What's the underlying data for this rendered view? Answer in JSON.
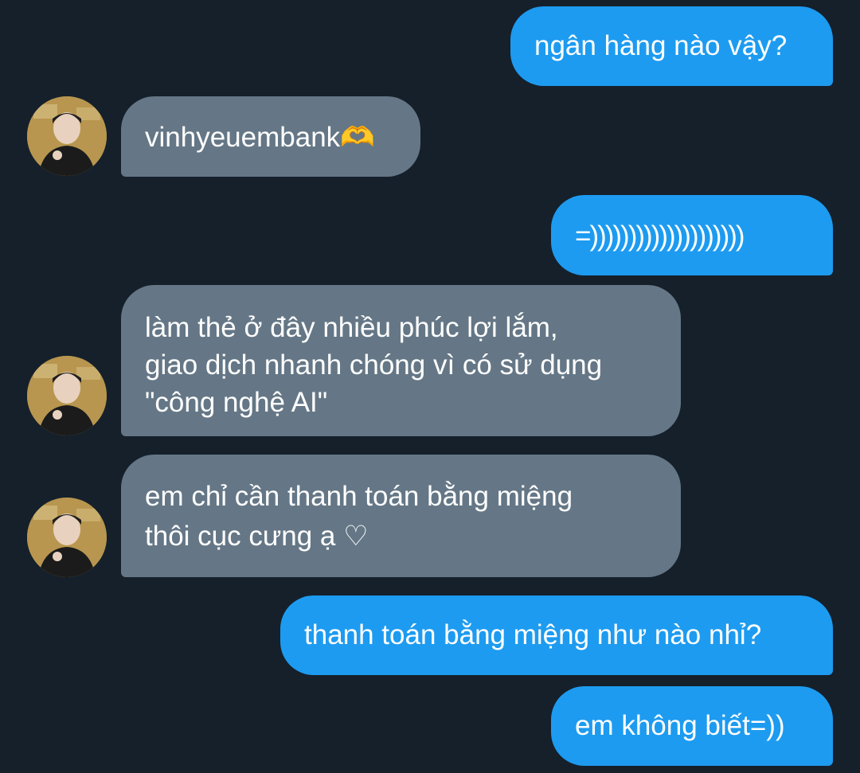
{
  "messages": [
    {
      "side": "sent",
      "lines": [
        "ngân hàng nào vậy?"
      ]
    },
    {
      "side": "recv",
      "lines": [
        "vinhyeuembank🫶"
      ]
    },
    {
      "side": "sent",
      "lines": [
        "=))))))))))))))))))))"
      ]
    },
    {
      "side": "recv",
      "lines": [
        "làm thẻ ở đây nhiều phúc lợi lắm,",
        "giao dịch nhanh chóng vì có sử dụng",
        "\"công nghệ AI\""
      ]
    },
    {
      "side": "recv",
      "lines": [
        "em chỉ cần thanh toán bằng miệng",
        "thôi cục cưng ạ ♡"
      ]
    },
    {
      "side": "sent",
      "lines": [
        "thanh toán bằng miệng như nào nhỉ?"
      ]
    },
    {
      "side": "sent",
      "lines": [
        "em không biết=))"
      ]
    }
  ],
  "colors": {
    "background": "#15202b",
    "sent_bubble": "#1d9bf0",
    "received_bubble": "#657786",
    "text": "#ffffff"
  },
  "icons": {
    "avatar": "user-avatar-photo"
  }
}
